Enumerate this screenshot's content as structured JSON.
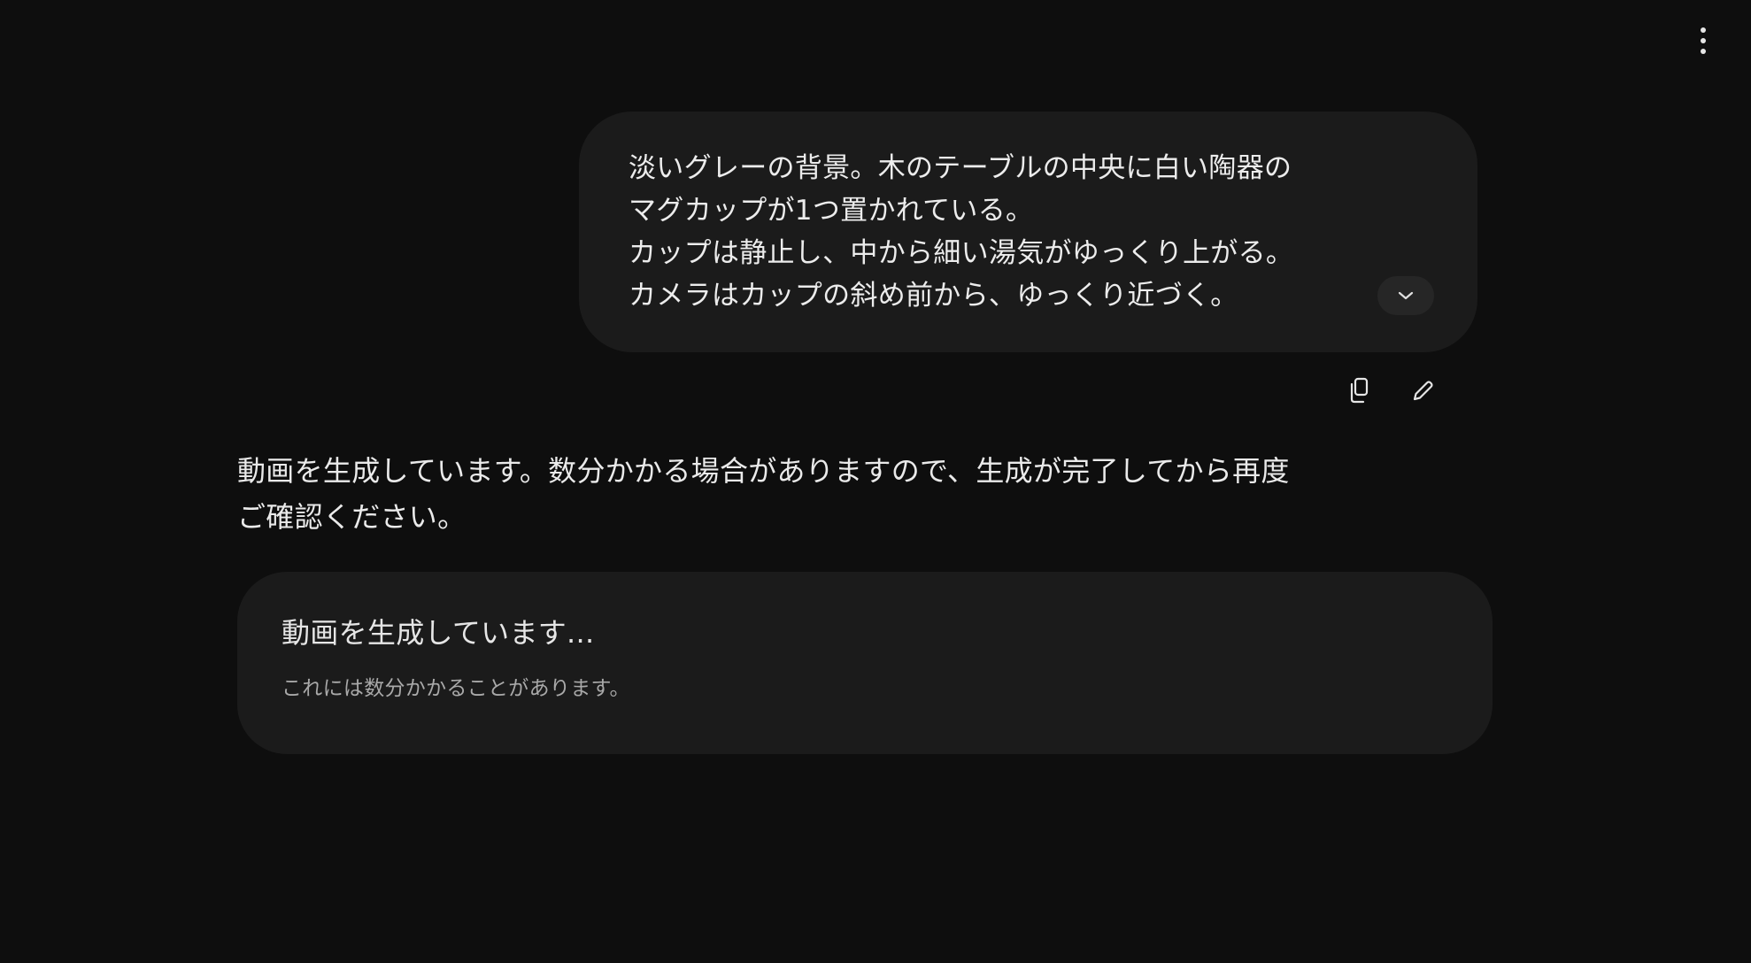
{
  "header": {
    "menu_icon": "more-vertical-icon"
  },
  "user_message": {
    "lines": [
      "淡いグレーの背景。木のテーブルの中央に白い陶器の",
      "マグカップが1つ置かれている。",
      "カップは静止し、中から細い湯気がゆっくり上がる。",
      "カメラはカップの斜め前から、ゆっくり近づく。"
    ],
    "expand_icon": "chevron-down-icon"
  },
  "message_actions": {
    "copy_icon": "copy-icon",
    "edit_icon": "pencil-icon"
  },
  "assistant_message": {
    "lines": [
      "動画を生成しています。数分かかる場合がありますので、生成が完了してから再度",
      "ご確認ください。"
    ]
  },
  "status_card": {
    "title": "動画を生成しています...",
    "subtitle": "これには数分かかることがあります。"
  },
  "colors": {
    "background": "#0e0e0e",
    "bubble": "#1b1b1b",
    "text": "#ececec",
    "muted": "#a9a9a9"
  }
}
